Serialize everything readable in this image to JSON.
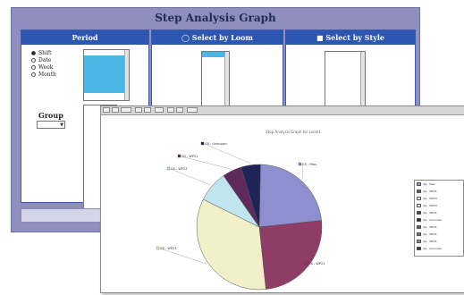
{
  "form": {
    "title": "Step Analysis Graph",
    "columns": {
      "period": {
        "header": "Period"
      },
      "loom": {
        "header": "Select by Loom"
      },
      "style": {
        "header": "Select by Style"
      }
    },
    "radio_options": [
      {
        "label": "Shift",
        "selected": true
      },
      {
        "label": "Date",
        "selected": false
      },
      {
        "label": "Week",
        "selected": false
      },
      {
        "label": "Month",
        "selected": false
      }
    ],
    "group_label": "Group"
  },
  "chart_data": {
    "type": "pie",
    "title": "Stop Analysis Graph for Loom1",
    "series": [
      {
        "label": "GS - Pass",
        "value": 23,
        "color": "#8e8fce"
      },
      {
        "label": "GS - WP21",
        "value": 25,
        "color": "#8f3c67"
      },
      {
        "label": "GS - WP23",
        "value": 34,
        "color": "#f2f0c9"
      },
      {
        "label": "GS - WP23",
        "value": 8,
        "color": "#bfe6ef"
      },
      {
        "label": "GS - WP21",
        "value": 5,
        "color": "#5e2a5b"
      },
      {
        "label": "GS - Unknown",
        "value": 5,
        "color": "#1f2458"
      }
    ],
    "legend": {
      "position": "right",
      "entries": [
        {
          "label": "GS - Pass",
          "color": "#8e8fce"
        },
        {
          "label": "GS - WP21",
          "color": "#8f3c67"
        },
        {
          "label": "GS - WP23",
          "color": "#f2f0c9"
        },
        {
          "label": "GS - WP23",
          "color": "#bfe6ef"
        },
        {
          "label": "GS - WP21",
          "color": "#5e2a5b"
        },
        {
          "label": "GS - Unknown",
          "color": "#1f2458"
        },
        {
          "label": "GS - WP21",
          "color": "#4a5ca8"
        },
        {
          "label": "GS - WP21",
          "color": "#b05a7f"
        },
        {
          "label": "GS - WP21",
          "color": "#6a8fc8"
        },
        {
          "label": "GS - Unknown",
          "color": "#2b2b7a"
        }
      ]
    }
  }
}
